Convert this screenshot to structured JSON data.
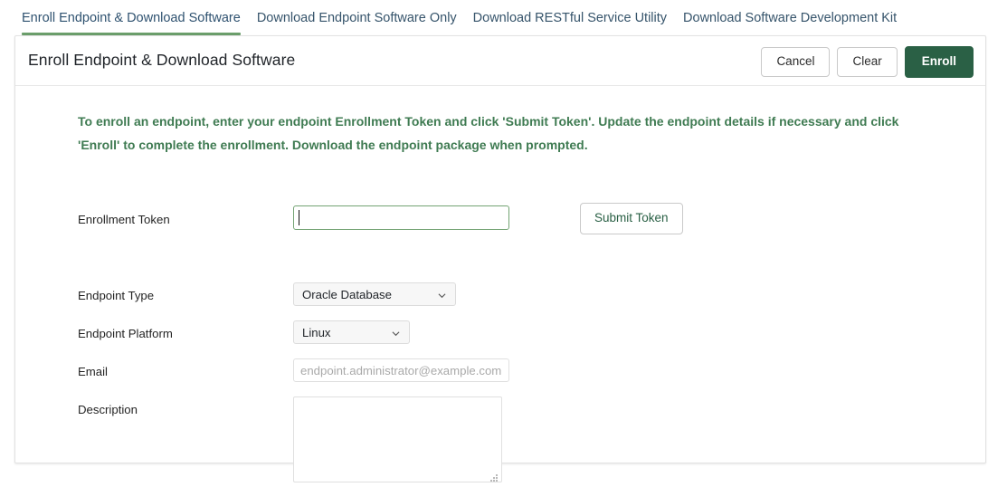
{
  "tabs": [
    {
      "label": "Enroll Endpoint & Download Software",
      "active": true
    },
    {
      "label": "Download Endpoint Software Only",
      "active": false
    },
    {
      "label": "Download RESTful Service Utility",
      "active": false
    },
    {
      "label": "Download Software Development Kit",
      "active": false
    }
  ],
  "card": {
    "title": "Enroll Endpoint & Download Software",
    "actions": {
      "cancel_label": "Cancel",
      "clear_label": "Clear",
      "enroll_label": "Enroll"
    }
  },
  "form": {
    "instructions": "To enroll an endpoint, enter your endpoint Enrollment Token and click 'Submit Token'. Update the endpoint details if necessary and click 'Enroll' to complete the enrollment. Download the endpoint package when prompted.",
    "enrollment_token": {
      "label": "Enrollment Token",
      "value": "",
      "placeholder": ""
    },
    "submit_token_label": "Submit Token",
    "endpoint_type": {
      "label": "Endpoint Type",
      "value": "Oracle Database",
      "icon": "chevron-down-icon"
    },
    "endpoint_platform": {
      "label": "Endpoint Platform",
      "value": "Linux",
      "icon": "chevron-down-icon"
    },
    "email": {
      "label": "Email",
      "value": "",
      "placeholder": "endpoint.administrator@example.com"
    },
    "description": {
      "label": "Description",
      "value": "",
      "placeholder": ""
    }
  },
  "colors": {
    "accent_green": "#2a6045",
    "instruction_green": "#3f7b52",
    "tab_underline": "#6b9e6b",
    "tab_text": "#36546b",
    "focus_border": "#73a373"
  }
}
